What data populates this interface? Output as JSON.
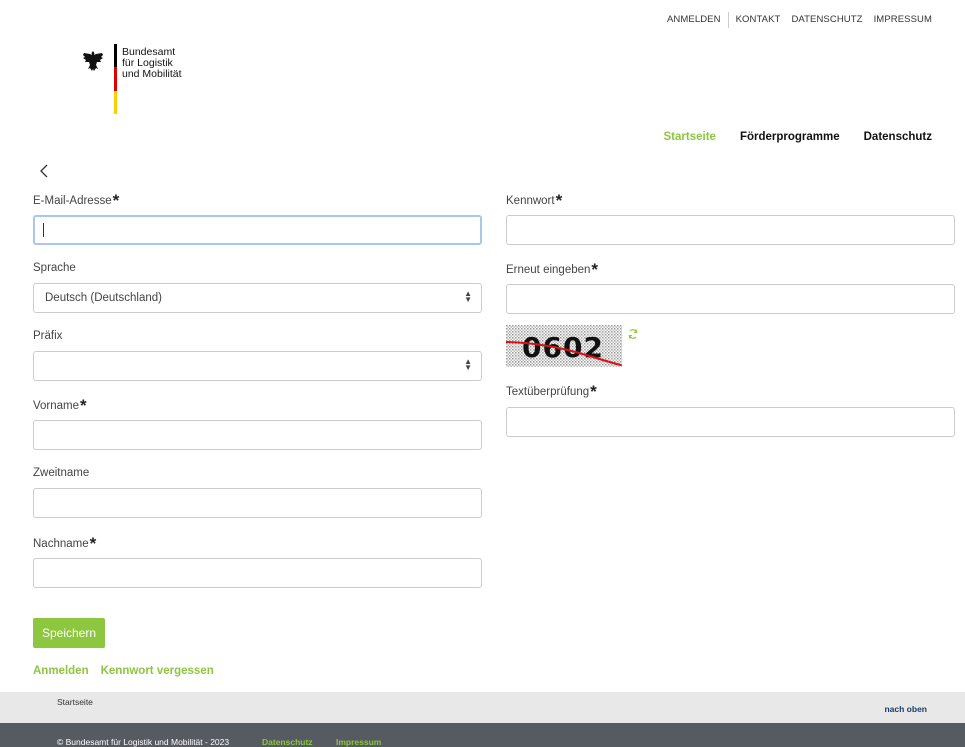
{
  "toplinks": {
    "login": "ANMELDEN",
    "contact": "KONTAKT",
    "privacy": "DATENSCHUTZ",
    "imprint": "IMPRESSUM"
  },
  "logo": {
    "line1": "Bundesamt",
    "line2": "für Logistik",
    "line3": "und Mobilität",
    "flag_colors": [
      "#000000",
      "#dd0000",
      "#ffce00"
    ]
  },
  "mainnav": {
    "home": "Startseite",
    "funding": "Förderprogramme",
    "privacy": "Datenschutz",
    "accent": "#8dc63f"
  },
  "back_icon": "chevron-left-icon",
  "form": {
    "email_label": "E-Mail-Adresse",
    "language_label": "Sprache",
    "language_value": "Deutsch (Deutschland)",
    "prefix_label": "Präfix",
    "prefix_value": "",
    "firstname_label": "Vorname",
    "middlename_label": "Zweitname",
    "lastname_label": "Nachname",
    "password_label": "Kennwort",
    "password_repeat_label": "Erneut eingeben",
    "captcha_text": "0602",
    "captcha_label": "Textüberprüfung",
    "required_marker": "*"
  },
  "save_button": "Speichern",
  "bottomlinks": {
    "login": "Anmelden",
    "forgot": "Kennwort vergessen"
  },
  "footer": {
    "home": "Startseite",
    "to_top": "nach oben",
    "copyright": "© Bundesamt für Logistik und Mobilität - 2023",
    "privacy": "Datenschutz",
    "imprint": "Impressum"
  }
}
